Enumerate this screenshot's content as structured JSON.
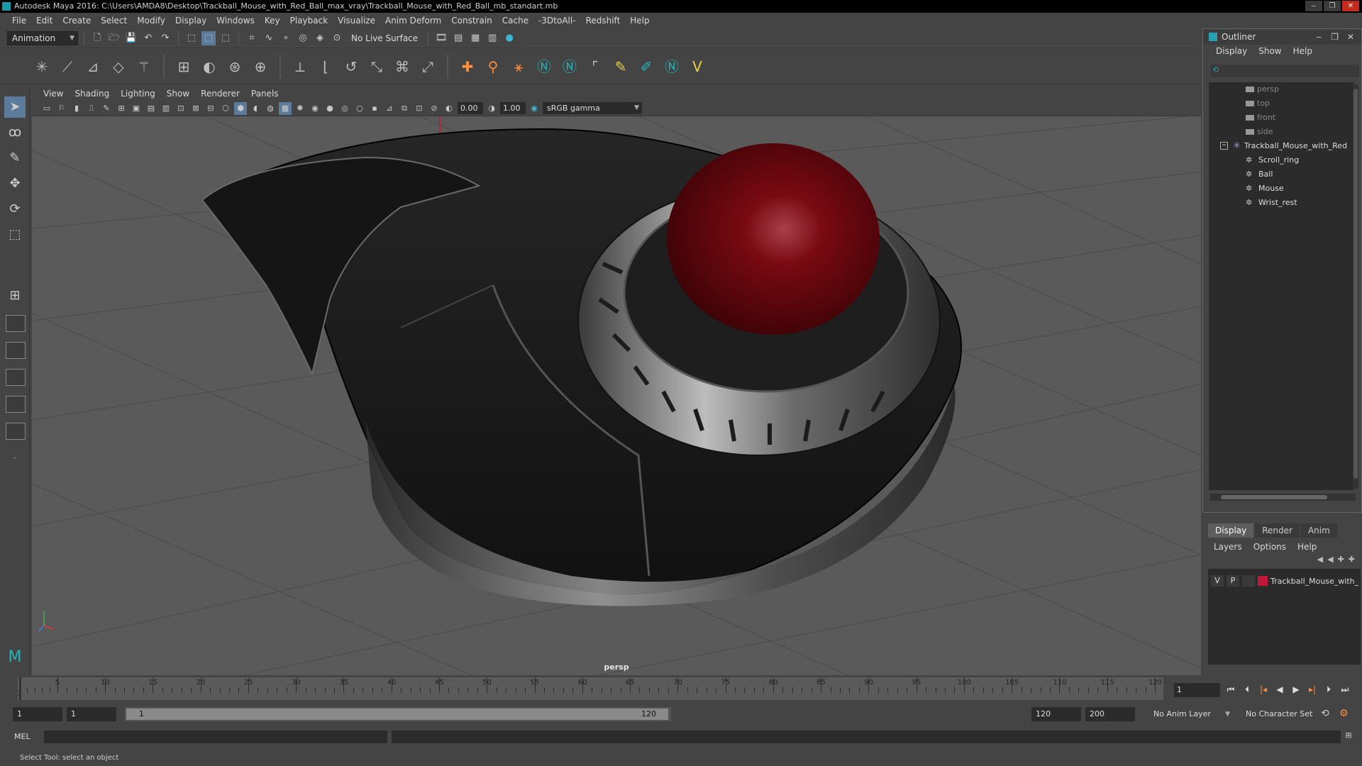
{
  "window": {
    "title": "Autodesk Maya 2016: C:\\Users\\AMDA8\\Desktop\\Trackball_Mouse_with_Red_Ball_max_vray\\Trackball_Mouse_with_Red_Ball_mb_standart.mb",
    "minimize": "‒",
    "maximize": "❐",
    "close": "✕"
  },
  "menubar": [
    "File",
    "Edit",
    "Create",
    "Select",
    "Modify",
    "Display",
    "Windows",
    "Key",
    "Playback",
    "Visualize",
    "Anim Deform",
    "Constrain",
    "Cache",
    "-3DtoAll-",
    "Redshift",
    "Help"
  ],
  "statusline": {
    "menuset": "Animation",
    "live_surface": "No Live Surface"
  },
  "panel": {
    "menu": [
      "View",
      "Shading",
      "Lighting",
      "Show",
      "Renderer",
      "Panels"
    ],
    "exposure": "0.00",
    "gamma": "1.00",
    "colorspace": "sRGB gamma",
    "camera_label": "persp"
  },
  "outliner": {
    "title": "Outliner",
    "menu": [
      "Display",
      "Show",
      "Help"
    ],
    "cameras": [
      "persp",
      "top",
      "front",
      "side"
    ],
    "group": "Trackball_Mouse_with_Red",
    "children": [
      "Scroll_ring",
      "Ball",
      "Mouse",
      "Wrist_rest"
    ]
  },
  "layer_editor": {
    "tabs": [
      "Display",
      "Render",
      "Anim"
    ],
    "menu": [
      "Layers",
      "Options",
      "Help"
    ],
    "layer": {
      "visible": "V",
      "playback": "P",
      "name": "Trackball_Mouse_with_",
      "color": "#c0183a"
    }
  },
  "timeline": {
    "ticks": [
      "1",
      "5",
      "10",
      "15",
      "20",
      "25",
      "30",
      "35",
      "40",
      "45",
      "50",
      "55",
      "60",
      "65",
      "70",
      "75",
      "80",
      "85",
      "90",
      "95",
      "100",
      "105",
      "110",
      "115",
      "120"
    ],
    "current_frame": "1"
  },
  "range": {
    "start": "1",
    "playback_start": "1",
    "slider_start": "1",
    "slider_end": "120",
    "playback_end": "120",
    "end": "200",
    "anim_layer": "No Anim Layer",
    "character_set": "No Character Set"
  },
  "cmdline": {
    "lang": "MEL"
  },
  "helpline": {
    "text": "Select Tool: select an object"
  },
  "colors": {
    "accent": "#5c7b9a",
    "ball": "#7a0a12",
    "body": "#1a1a1a"
  }
}
